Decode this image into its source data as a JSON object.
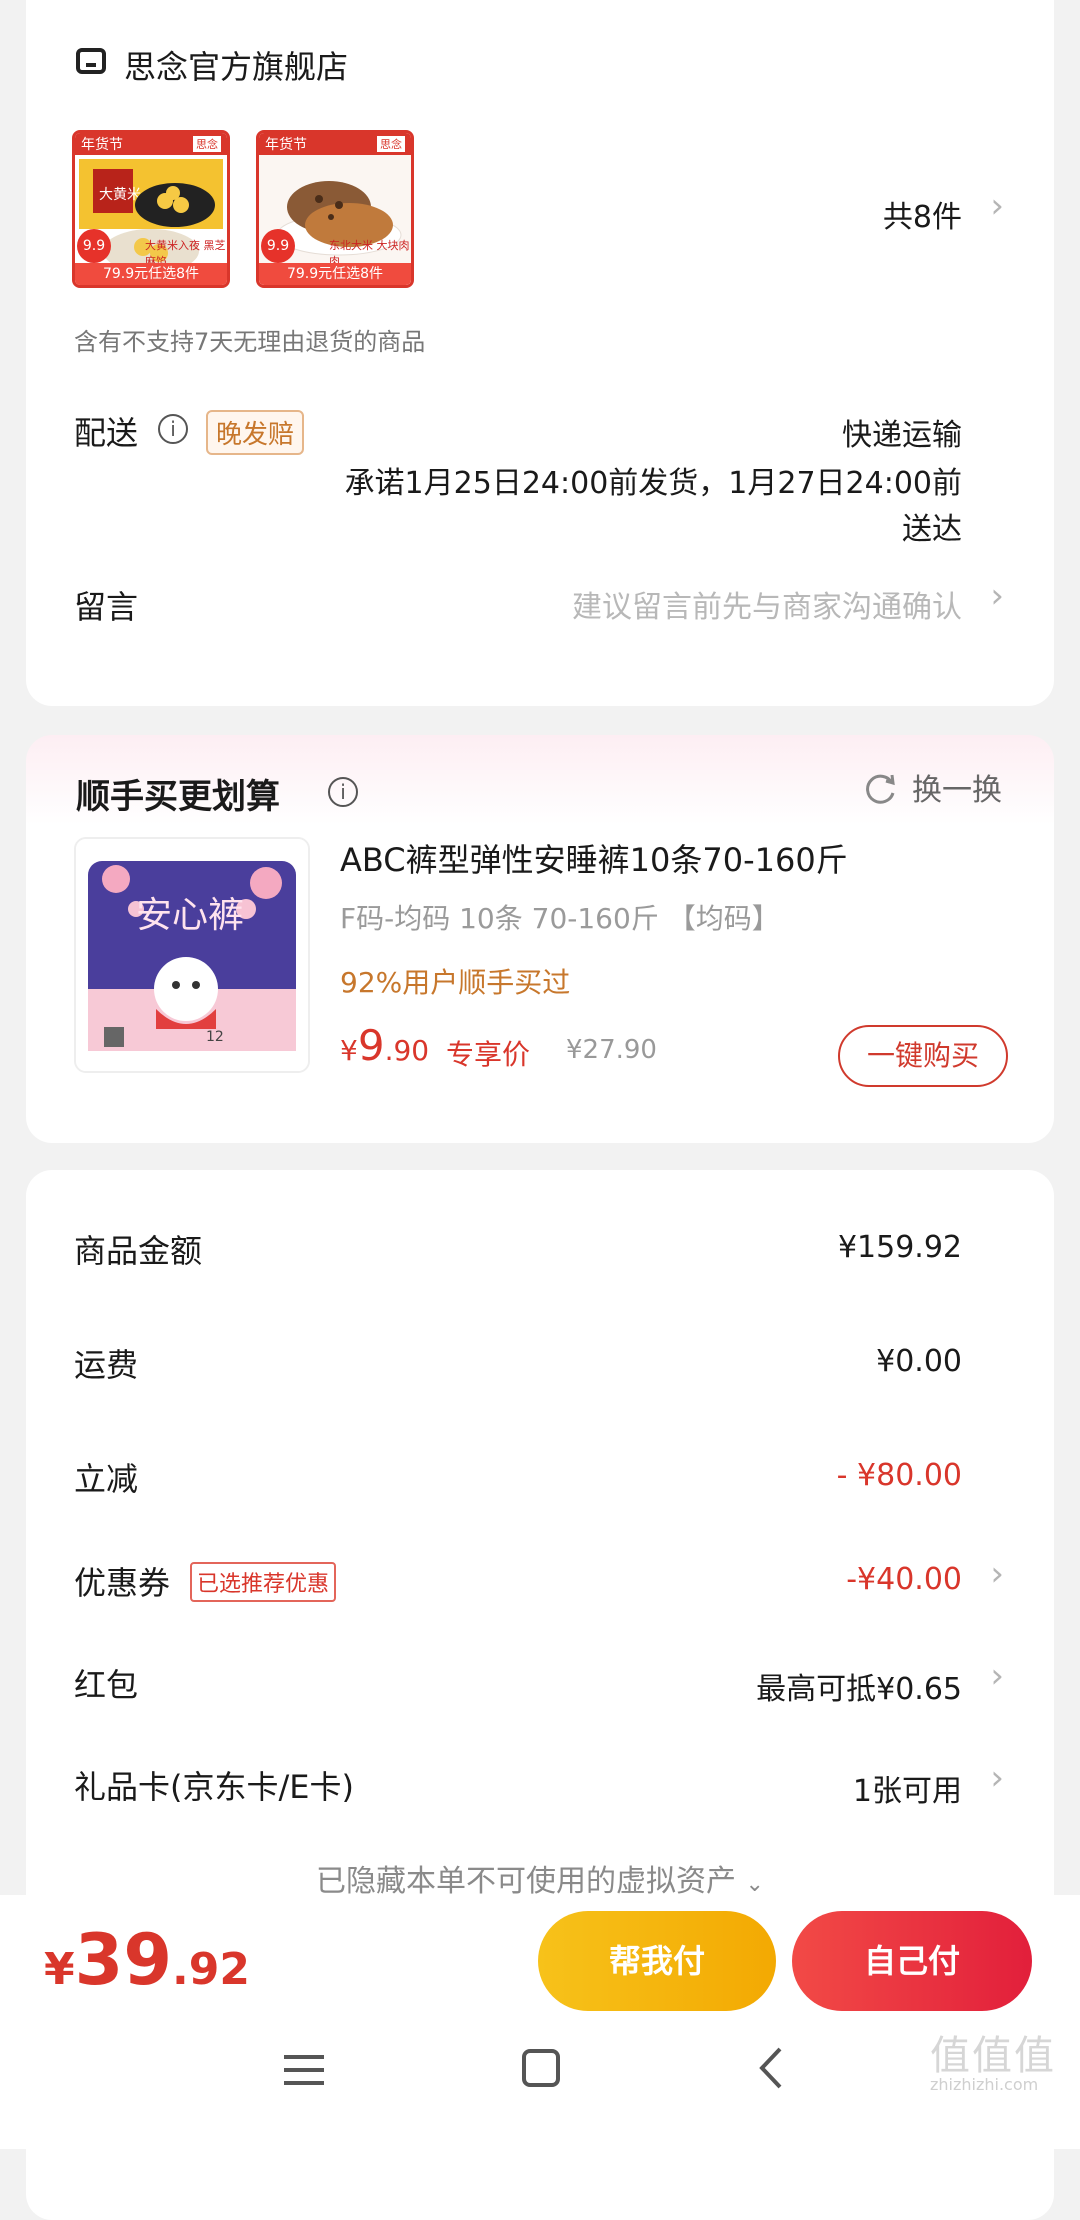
{
  "store": {
    "name": "思念官方旗舰店",
    "count_text": "共8件",
    "notice": "含有不支持7天无理由退货的商品",
    "thumbs": [
      {
        "top_label": "年货节",
        "price_badge": "9.9",
        "bar_text": "79.9元任选8件"
      },
      {
        "top_label": "年货节",
        "price_badge": "9.9",
        "bar_text": "79.9元任选8件"
      }
    ]
  },
  "delivery": {
    "label": "配送",
    "late_badge": "晚发赔",
    "method": "快递运输",
    "promise_line1": "承诺1月25日24:00前发货，1月27日24:00前",
    "promise_line2": "送达"
  },
  "message": {
    "label": "留言",
    "placeholder": "建议留言前先与商家沟通确认"
  },
  "addon": {
    "title": "顺手买更划算",
    "refresh_label": "换一换",
    "product": {
      "name": "ABC裤型弹性安睡裤10条70-160斤",
      "spec": "F码-均码 10条 70-160斤 【均码】",
      "social": "92%用户顺手买过",
      "price_symbol": "¥",
      "price_int": "9",
      "price_dec": ".90",
      "price_tag": "专享价",
      "original_price": "¥27.90",
      "buy_label": "一键购买",
      "image_number": "12"
    }
  },
  "summary": {
    "rows": [
      {
        "label": "商品金额",
        "value": "¥159.92"
      },
      {
        "label": "运费",
        "value": "¥0.00"
      },
      {
        "label": "立减",
        "value": "- ¥80.00"
      },
      {
        "label": "优惠券",
        "badge": "已选推荐优惠",
        "value": "-¥40.00"
      },
      {
        "label": "红包",
        "value": "最高可抵¥0.65"
      },
      {
        "label": "礼品卡(京东卡/E卡)",
        "value": "1张可用"
      }
    ],
    "hidden_assets": "已隐藏本单不可使用的虚拟资产"
  },
  "bottom": {
    "total_symbol": "¥",
    "total_int": "39",
    "total_dec": ".92",
    "help_pay": "帮我付",
    "self_pay": "自己付"
  },
  "watermark": {
    "logo": "值值值",
    "url": "zhizhizhi.com"
  },
  "colors": {
    "accent_red": "#d9362b",
    "help_pay_yellow": "#f7b500",
    "self_pay_red": "#e8383d",
    "orange_text": "#c7772c"
  }
}
